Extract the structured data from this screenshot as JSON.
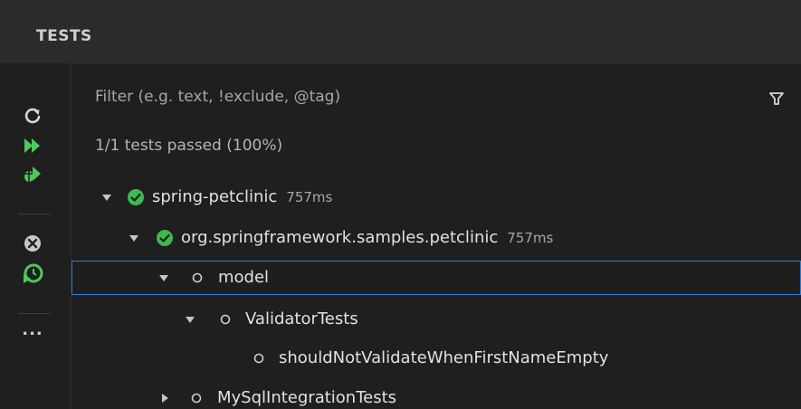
{
  "panel": {
    "title": "TESTS"
  },
  "toolbar": {
    "buttons": [
      {
        "name": "refresh-tests-button",
        "icon": "refresh-icon"
      },
      {
        "name": "run-all-tests-button",
        "icon": "run-all-icon"
      },
      {
        "name": "debug-all-tests-button",
        "icon": "debug-all-icon"
      },
      {
        "name": "cancel-tests-button",
        "icon": "cancel-icon"
      },
      {
        "name": "continuous-run-button",
        "icon": "watch-run-icon"
      },
      {
        "name": "more-actions-button",
        "icon": "more-icon",
        "label": "..."
      }
    ]
  },
  "filter": {
    "placeholder": "Filter (e.g. text, !exclude, @tag)"
  },
  "summary": {
    "text": "1/1 tests passed (100%)"
  },
  "tree": [
    {
      "label": "spring-petclinic",
      "duration": "757ms",
      "status": "passed",
      "expanded": true
    },
    {
      "label": "org.springframework.samples.petclinic",
      "duration": "757ms",
      "status": "passed",
      "expanded": true
    },
    {
      "label": "model",
      "duration": "",
      "status": "unset",
      "expanded": true,
      "selected": true
    },
    {
      "label": "ValidatorTests",
      "duration": "",
      "status": "unset",
      "expanded": true
    },
    {
      "label": "shouldNotValidateWhenFirstNameEmpty",
      "duration": "",
      "status": "unset",
      "expanded": null
    },
    {
      "label": "MySqlIntegrationTests",
      "duration": "",
      "status": "unset",
      "expanded": false
    }
  ],
  "colors": {
    "passed": "#3fb950",
    "accent": "#2f7ad8",
    "run": "#4ec95b",
    "text": "#e1e1e1",
    "muted": "#a8a8a8"
  }
}
